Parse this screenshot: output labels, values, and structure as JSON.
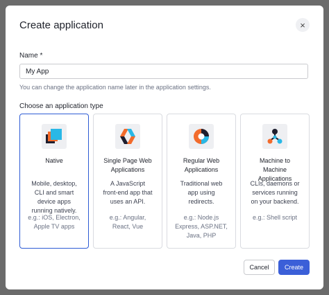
{
  "dialog": {
    "title": "Create application",
    "close_glyph": "×"
  },
  "name_field": {
    "label": "Name *",
    "value": "My App",
    "hint": "You can change the application name later in the application settings."
  },
  "type_section": {
    "label": "Choose an application type",
    "selected": "Native",
    "cards": [
      {
        "icon": "native-app-icon",
        "title": "Native",
        "description": "Mobile, desktop,\nCLI and smart\ndevice apps\nrunning natively.",
        "example": "e.g.: iOS, Electron,\nApple TV apps"
      },
      {
        "icon": "spa-app-icon",
        "title": "Single Page Web\nApplications",
        "description": "A JavaScript\nfront-end app that\nuses an API.",
        "example": "e.g.: Angular,\nReact, Vue"
      },
      {
        "icon": "regular-web-app-icon",
        "title": "Regular Web\nApplications",
        "description": "Traditional web\napp using\nredirects.",
        "example": "e.g.: Node.js\nExpress, ASP.NET,\nJava, PHP"
      },
      {
        "icon": "m2m-app-icon",
        "title": "Machine to\nMachine\nApplications",
        "description": "CLIs, daemons or\nservices running\non your backend.",
        "example": "e.g.: Shell script"
      }
    ]
  },
  "footer": {
    "cancel_label": "Cancel",
    "create_label": "Create"
  },
  "colors": {
    "accent": "#3b5fd8",
    "selected_border": "#2d5bd4",
    "backdrop": "#6b6b6b"
  }
}
